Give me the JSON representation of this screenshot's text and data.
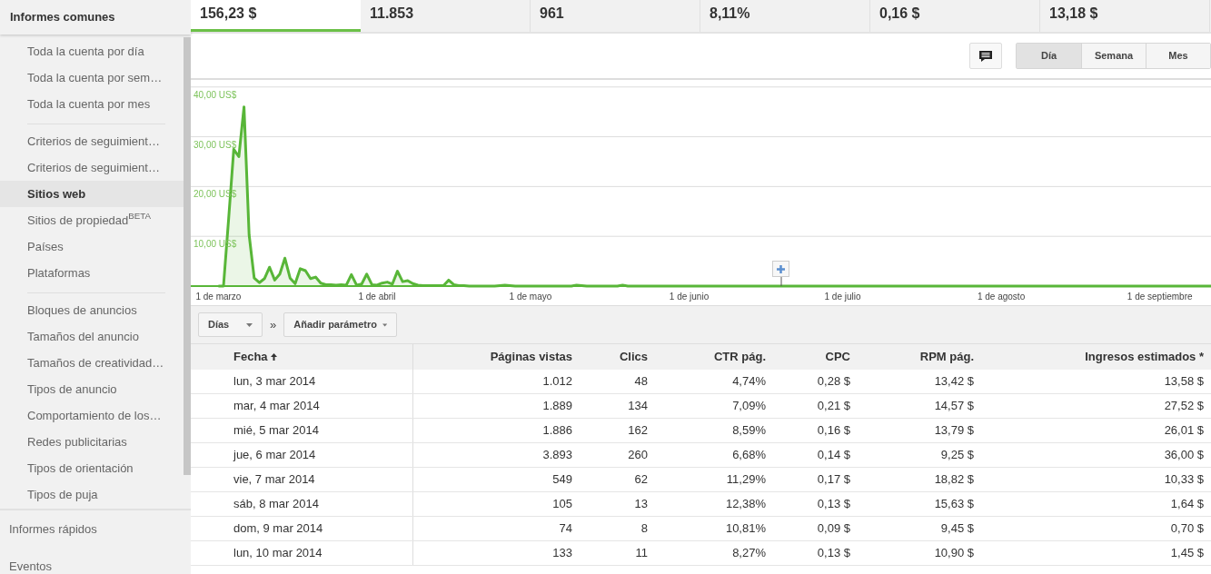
{
  "sidebar": {
    "header": "Informes comunes",
    "groups": [
      [
        {
          "label": "Toda la cuenta por día",
          "selected": false
        },
        {
          "label": "Toda la cuenta por sem…",
          "selected": false
        },
        {
          "label": "Toda la cuenta por mes",
          "selected": false
        }
      ],
      [
        {
          "label": "Criterios de seguimient…",
          "selected": false
        },
        {
          "label": "Criterios de seguimient…",
          "selected": false
        },
        {
          "label": "Sitios web",
          "selected": true
        },
        {
          "label": "Sitios de propiedad$^{BETA}$",
          "selected": false
        },
        {
          "label": "Países",
          "selected": false
        },
        {
          "label": "Plataformas",
          "selected": false
        }
      ],
      [
        {
          "label": "Bloques de anuncios",
          "selected": false
        },
        {
          "label": "Tamaños del anuncio",
          "selected": false
        },
        {
          "label": "Tamaños de creatividad…",
          "selected": false
        },
        {
          "label": "Tipos de anuncio",
          "selected": false
        },
        {
          "label": "Comportamiento de los…",
          "selected": false
        },
        {
          "label": "Redes publicitarias",
          "selected": false
        },
        {
          "label": "Tipos de orientación",
          "selected": false
        },
        {
          "label": "Tipos de puja",
          "selected": false
        }
      ]
    ],
    "sections": [
      "Informes rápidos",
      "Eventos"
    ]
  },
  "metrics": [
    {
      "value": "156,23 $",
      "selected": true
    },
    {
      "value": "11.853",
      "selected": false
    },
    {
      "value": "961",
      "selected": false
    },
    {
      "value": "8,11%",
      "selected": false
    },
    {
      "value": "0,16 $",
      "selected": false
    },
    {
      "value": "13,18 $",
      "selected": false
    }
  ],
  "granularity": [
    {
      "label": "Día",
      "selected": true
    },
    {
      "label": "Semana",
      "selected": false
    },
    {
      "label": "Mes",
      "selected": false
    }
  ],
  "chart_data": {
    "type": "area",
    "grid": true,
    "ylim": [
      0,
      41.6
    ],
    "categories": [
      "1 de marzo",
      null,
      null,
      null,
      null,
      null,
      null,
      null,
      null,
      null,
      null,
      null,
      null,
      null,
      null,
      null,
      null,
      null,
      null,
      null,
      null,
      null,
      null,
      null,
      null,
      null,
      null,
      null,
      null,
      null,
      null,
      "1 de abril",
      null,
      null,
      null,
      null,
      null,
      null,
      null,
      null,
      null,
      null,
      null,
      null,
      null,
      null,
      null,
      null,
      null,
      null,
      null,
      null,
      null,
      null,
      null,
      null,
      null,
      null,
      null,
      null,
      null,
      "1 de mayo",
      null,
      null,
      null,
      null,
      null,
      null,
      null,
      null,
      null,
      null,
      null,
      null,
      null,
      null,
      null,
      null,
      null,
      null,
      null,
      null,
      null,
      null,
      null,
      null,
      null,
      null,
      null,
      null,
      null,
      null,
      "1 de junio",
      null,
      null,
      null,
      null,
      null,
      null,
      null,
      null,
      null,
      null,
      null,
      null,
      null,
      null,
      null,
      null,
      null,
      null,
      null,
      null,
      null,
      null,
      null,
      null,
      null,
      null,
      null,
      null,
      null,
      "1 de julio",
      null,
      null,
      null,
      null,
      null,
      null,
      null,
      null,
      null,
      null,
      null,
      null,
      null,
      null,
      null,
      null,
      null,
      null,
      null,
      null,
      null,
      null,
      null,
      null,
      null,
      null,
      null,
      null,
      null,
      null,
      "1 de agosto",
      null,
      null,
      null,
      null,
      null,
      null,
      null,
      null,
      null,
      null,
      null,
      null,
      null,
      null,
      null,
      null,
      null,
      null,
      null,
      null,
      null,
      null,
      null,
      null,
      null,
      null,
      null,
      null,
      null,
      null,
      "1 de septiembre",
      null,
      null,
      null,
      null,
      null,
      null,
      null,
      null,
      null,
      null
    ],
    "yticks": [
      {
        "value": 10,
        "label": "10,00 US$"
      },
      {
        "value": 20,
        "label": "20,00 US$"
      },
      {
        "value": 30,
        "label": "30,00 US$"
      },
      {
        "value": 40,
        "label": "40,00 US$"
      }
    ],
    "series": [
      {
        "color": "#58b638",
        "values": [
          0,
          0,
          13.6,
          27.5,
          26,
          36,
          10.3,
          1.6,
          0.7,
          1.5,
          3.8,
          1.2,
          2.4,
          5.6,
          1.6,
          0.5,
          3.5,
          3.1,
          1.5,
          1.8,
          0.6,
          0.3,
          0.3,
          0.2,
          0.3,
          0.2,
          2.3,
          0.2,
          0.4,
          2.4,
          0.3,
          0.2,
          0.6,
          0.8,
          0.4,
          3.0,
          0.9,
          1.1,
          0.5,
          0.2,
          0.1,
          0.1,
          0.1,
          0.1,
          0.1,
          1.2,
          0.3,
          0.1,
          0.1,
          0,
          0,
          0,
          0,
          0,
          0,
          0.1,
          0.2,
          0.1,
          0,
          0,
          0,
          0,
          0,
          0,
          0,
          0,
          0,
          0,
          0,
          0,
          0.2,
          0.1,
          0,
          0,
          0,
          0,
          0,
          0,
          0,
          0.2,
          0,
          0,
          0,
          0,
          0,
          0,
          0,
          0,
          0,
          0,
          0,
          0,
          0,
          0,
          0,
          0,
          0,
          0,
          0,
          0,
          0,
          0,
          0,
          0,
          0,
          0,
          0,
          0,
          0,
          0,
          0,
          0,
          0,
          0,
          0,
          0,
          0,
          0,
          0,
          0,
          0,
          0,
          0,
          0,
          0,
          0,
          0,
          0,
          0,
          0,
          0,
          0,
          0,
          0,
          0,
          0,
          0,
          0,
          0,
          0,
          0,
          0,
          0,
          0,
          0,
          0,
          0,
          0,
          0,
          0,
          0,
          0,
          0,
          0,
          0,
          0,
          0,
          0,
          0,
          0,
          0,
          0,
          0,
          0,
          0,
          0,
          0,
          0,
          0,
          0,
          0,
          0,
          0,
          0,
          0,
          0,
          0,
          0,
          0,
          0,
          0,
          0,
          0,
          0,
          0,
          0,
          0,
          0,
          0,
          0,
          0,
          0,
          0,
          0,
          0
        ]
      }
    ]
  },
  "filters": {
    "dimension": "Días",
    "separator": "»",
    "add": "Añadir parámetro"
  },
  "table": {
    "columns": [
      {
        "label": "Fecha",
        "sorted": true
      },
      {
        "label": "Páginas vistas",
        "sorted": false
      },
      {
        "label": "Clics",
        "sorted": false
      },
      {
        "label": "CTR pág.",
        "sorted": false
      },
      {
        "label": "CPC",
        "sorted": false
      },
      {
        "label": "RPM pág.",
        "sorted": false
      },
      {
        "label": "Ingresos estimados *",
        "sorted": false
      }
    ],
    "rows": [
      [
        "lun, 3 mar 2014",
        "1.012",
        "48",
        "4,74%",
        "0,28 $",
        "13,42 $",
        "13,58 $"
      ],
      [
        "mar, 4 mar 2014",
        "1.889",
        "134",
        "7,09%",
        "0,21 $",
        "14,57 $",
        "27,52 $"
      ],
      [
        "mié, 5 mar 2014",
        "1.886",
        "162",
        "8,59%",
        "0,16 $",
        "13,79 $",
        "26,01 $"
      ],
      [
        "jue, 6 mar 2014",
        "3.893",
        "260",
        "6,68%",
        "0,14 $",
        "9,25 $",
        "36,00 $"
      ],
      [
        "vie, 7 mar 2014",
        "549",
        "62",
        "11,29%",
        "0,17 $",
        "18,82 $",
        "10,33 $"
      ],
      [
        "sáb, 8 mar 2014",
        "105",
        "13",
        "12,38%",
        "0,13 $",
        "15,63 $",
        "1,64 $"
      ],
      [
        "dom, 9 mar 2014",
        "74",
        "8",
        "10,81%",
        "0,09 $",
        "9,45 $",
        "0,70 $"
      ],
      [
        "lun, 10 mar 2014",
        "133",
        "11",
        "8,27%",
        "0,13 $",
        "10,90 $",
        "1,45 $"
      ]
    ]
  }
}
